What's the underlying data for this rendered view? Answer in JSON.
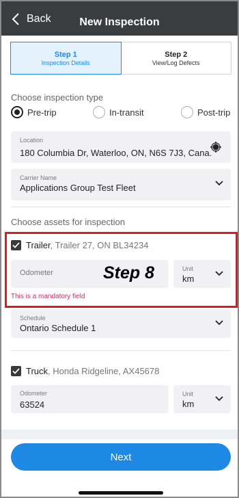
{
  "header": {
    "back_label": "Back",
    "title": "New Inspection"
  },
  "stepper": {
    "steps": [
      {
        "label": "Step 1",
        "sub": "Inspection Details",
        "active": true
      },
      {
        "label": "Step 2",
        "sub": "View/Log Defects",
        "active": false
      }
    ]
  },
  "inspection_type": {
    "label": "Choose inspection type",
    "options": [
      {
        "label": "Pre-trip",
        "checked": true
      },
      {
        "label": "In-transit",
        "checked": false
      },
      {
        "label": "Post-trip",
        "checked": false
      }
    ]
  },
  "location": {
    "label": "Location",
    "value": "180 Columbia Dr, Waterloo, ON, N6S 7J3, Cana..."
  },
  "carrier": {
    "label": "Carrier Name",
    "value": "Applications Group Test Fleet"
  },
  "assets": {
    "label": "Choose assets for inspection",
    "trailer": {
      "name": "Trailer",
      "details": ", Trailer 27, ON BL34234",
      "odometer_label": "Odometer",
      "odometer_value": "",
      "unit_label": "Unit",
      "unit_value": "km",
      "error": "This is a mandatory field",
      "schedule_label": "Schedule",
      "schedule_value": "Ontario Schedule 1"
    },
    "truck": {
      "name": "Truck",
      "details": ", Honda Ridgeline, AX45678",
      "odometer_label": "Odometer",
      "odometer_value": "63524",
      "unit_label": "Unit",
      "unit_value": "km"
    }
  },
  "annotation": "Step 8",
  "next_label": "Next",
  "colors": {
    "header_bg": "#3b3c3e",
    "accent": "#1e88e5",
    "error": "#e0245e",
    "highlight_box": "#e3181f"
  }
}
